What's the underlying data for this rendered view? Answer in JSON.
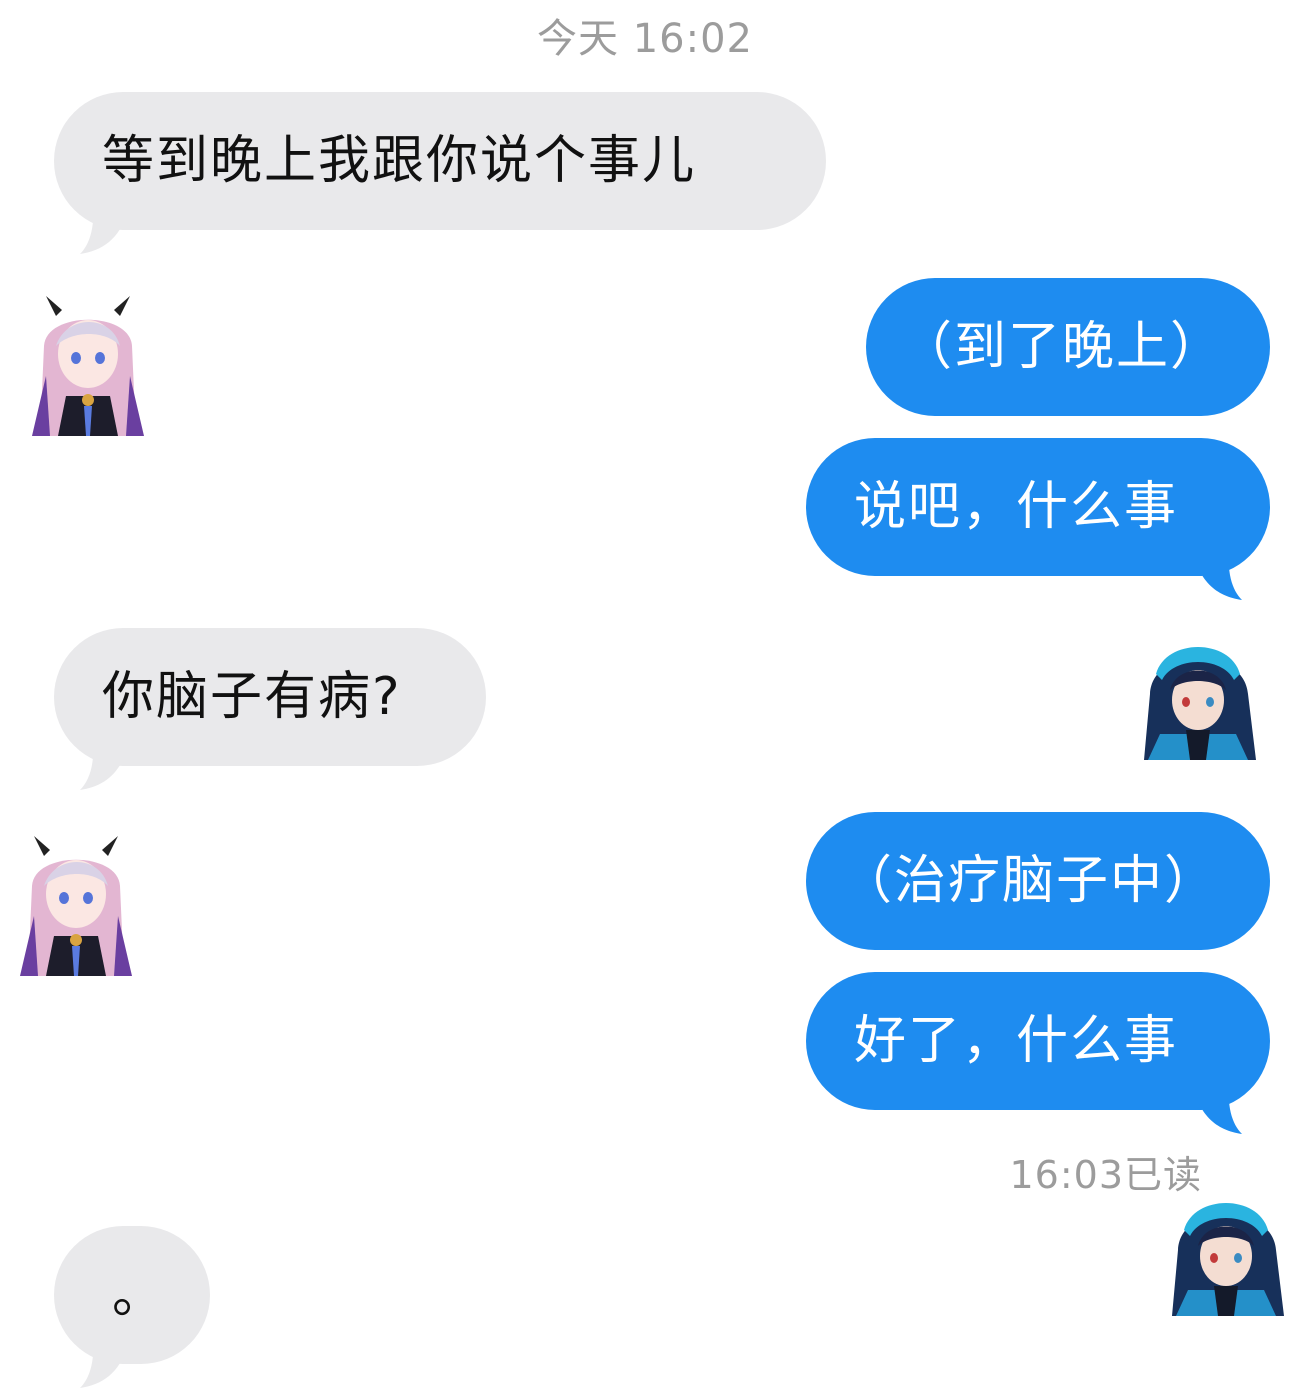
{
  "header": {
    "timestamp": "今天 16:02"
  },
  "messages": [
    {
      "from": "them",
      "text": "等到晚上我跟你说个事儿"
    },
    {
      "from": "me",
      "text": "（到了晚上）"
    },
    {
      "from": "me",
      "text": "说吧，什么事"
    },
    {
      "from": "them",
      "text": "你脑子有病?"
    },
    {
      "from": "me",
      "text": "（治疗脑子中）"
    },
    {
      "from": "me",
      "text": "好了，什么事"
    },
    {
      "from": "them",
      "text": "。"
    }
  ],
  "receipt": {
    "text": "16:03已读"
  },
  "colors": {
    "incoming_bubble": "#e9e9eb",
    "outgoing_bubble": "#1e8cf0",
    "meta_text": "#9c9c9c"
  },
  "avatars": {
    "them": "pink-haired-anime-girl-avatar",
    "me": "blue-hooded-anime-boy-avatar"
  }
}
